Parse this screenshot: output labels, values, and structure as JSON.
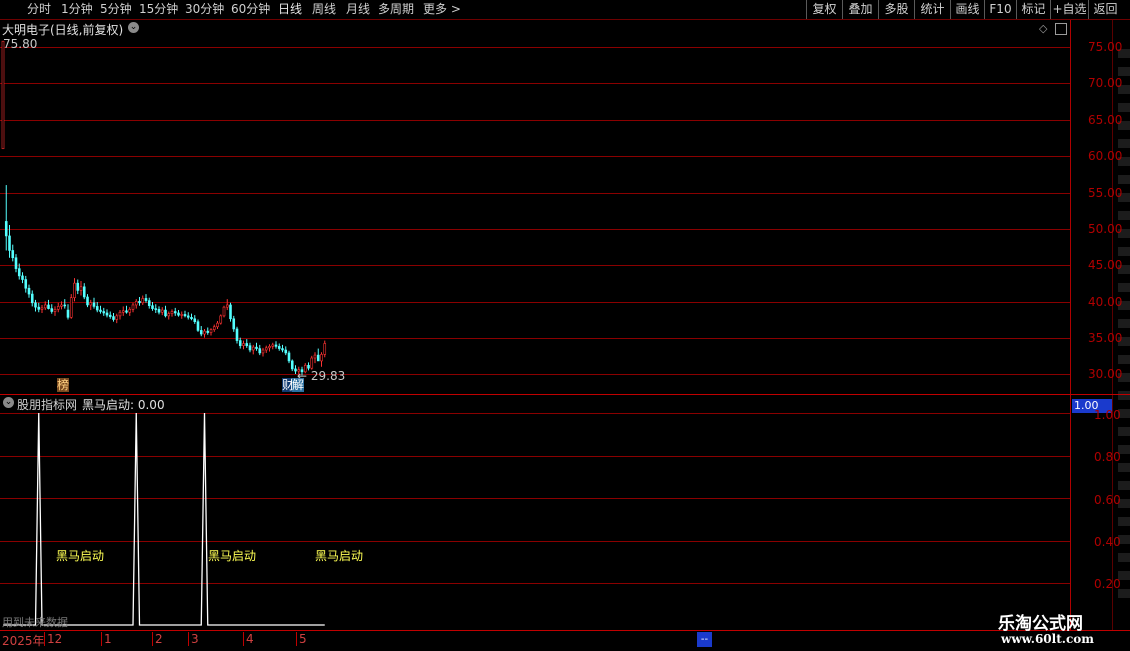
{
  "toolbar": {
    "periods": [
      "分时",
      "1分钟",
      "5分钟",
      "15分钟",
      "30分钟",
      "60分钟",
      "日线",
      "周线",
      "月线",
      "多周期",
      "更多 >"
    ],
    "actions": [
      "复权",
      "叠加",
      "多股",
      "统计",
      "画线",
      "F10",
      "标记",
      "+自选",
      "返回"
    ]
  },
  "main": {
    "title": "大明电子(日线,前复权)",
    "high_label": "75.80",
    "low_label": "← 29.83",
    "badge_left": "榜",
    "badge_right_1": "财",
    "badge_right_2": "解",
    "y_ticks": [
      "75.00",
      "70.00",
      "65.00",
      "60.00",
      "55.00",
      "50.00",
      "45.00",
      "40.00",
      "35.00",
      "30.00"
    ]
  },
  "indicator": {
    "source": "股朋指标网",
    "name_value": "黑马启动: 0.00",
    "signal_label": "黑马启动",
    "current_value": "1.00",
    "y_ticks": [
      "1.00",
      "0.80",
      "0.60",
      "0.40",
      "0.20"
    ],
    "footer_note": "用到未来数据"
  },
  "time_axis": {
    "labels": [
      "2025年",
      "12",
      "1",
      "2",
      "3",
      "4",
      "5"
    ],
    "marker": "--"
  },
  "colors": {
    "up": "#ff3232",
    "down": "#54ffff",
    "grid": "#8a0000",
    "axis": "#c00000",
    "signal": "#ffff54"
  },
  "watermark": {
    "title": "乐淘公式网",
    "url": "www.60lt.com"
  },
  "chart_data": {
    "type": "candlestick",
    "ylim": [
      28,
      77
    ],
    "candles": [
      [
        61.0,
        75.8,
        61.0,
        75.8
      ],
      [
        51.0,
        56.0,
        47.0,
        49.0
      ],
      [
        49.0,
        50.5,
        46.0,
        47.0
      ],
      [
        47.0,
        47.8,
        45.5,
        46.0
      ],
      [
        46.0,
        46.5,
        44.0,
        44.5
      ],
      [
        44.5,
        45.2,
        43.0,
        43.5
      ],
      [
        43.5,
        44.0,
        42.5,
        43.0
      ],
      [
        43.0,
        43.5,
        41.2,
        41.8
      ],
      [
        41.8,
        42.3,
        40.5,
        41.0
      ],
      [
        41.0,
        41.5,
        39.3,
        39.8
      ],
      [
        39.8,
        40.2,
        38.6,
        39.2
      ],
      [
        39.2,
        39.8,
        38.5,
        38.9
      ],
      [
        38.9,
        39.5,
        38.4,
        39.1
      ],
      [
        39.1,
        40.0,
        38.8,
        39.5
      ],
      [
        39.5,
        40.2,
        38.9,
        39.0
      ],
      [
        39.0,
        39.6,
        38.3,
        38.6
      ],
      [
        38.6,
        39.3,
        38.0,
        38.9
      ],
      [
        38.9,
        39.8,
        38.5,
        39.3
      ],
      [
        39.3,
        40.0,
        38.9,
        39.5
      ],
      [
        39.5,
        40.3,
        39.0,
        39.4
      ],
      [
        38.8,
        39.6,
        37.5,
        37.8
      ],
      [
        37.8,
        41.0,
        37.6,
        40.5
      ],
      [
        40.5,
        43.2,
        40.0,
        42.5
      ],
      [
        42.5,
        43.0,
        41.0,
        41.5
      ],
      [
        41.5,
        42.8,
        40.8,
        42.0
      ],
      [
        42.0,
        42.5,
        40.3,
        40.6
      ],
      [
        40.6,
        41.0,
        39.2,
        39.5
      ],
      [
        39.5,
        40.2,
        38.8,
        39.8
      ],
      [
        39.8,
        40.5,
        39.0,
        39.3
      ],
      [
        39.3,
        39.9,
        38.5,
        38.8
      ],
      [
        38.8,
        39.4,
        38.3,
        38.6
      ],
      [
        38.6,
        39.1,
        38.0,
        38.4
      ],
      [
        38.4,
        38.9,
        37.8,
        38.1
      ],
      [
        38.1,
        38.6,
        37.6,
        37.9
      ],
      [
        37.9,
        38.4,
        37.2,
        37.5
      ],
      [
        37.5,
        38.3,
        37.0,
        38.0
      ],
      [
        38.0,
        38.8,
        37.5,
        38.5
      ],
      [
        38.5,
        39.3,
        38.0,
        38.7
      ],
      [
        38.7,
        39.4,
        38.3,
        38.5
      ],
      [
        38.5,
        39.2,
        38.0,
        38.9
      ],
      [
        38.9,
        39.8,
        38.5,
        39.5
      ],
      [
        39.5,
        40.3,
        39.0,
        40.0
      ],
      [
        40.0,
        40.6,
        39.4,
        39.8
      ],
      [
        39.8,
        40.8,
        39.5,
        40.4
      ],
      [
        40.4,
        41.0,
        39.8,
        40.1
      ],
      [
        40.1,
        40.5,
        39.0,
        39.4
      ],
      [
        39.4,
        39.9,
        38.7,
        39.0
      ],
      [
        39.0,
        39.6,
        38.4,
        38.9
      ],
      [
        38.9,
        39.3,
        38.2,
        38.5
      ],
      [
        38.5,
        39.2,
        38.1,
        38.8
      ],
      [
        38.8,
        39.4,
        37.8,
        38.0
      ],
      [
        38.0,
        38.6,
        37.5,
        38.3
      ],
      [
        38.3,
        38.9,
        37.9,
        38.6
      ],
      [
        38.6,
        39.1,
        38.0,
        38.4
      ],
      [
        38.4,
        38.8,
        37.9,
        38.1
      ],
      [
        38.1,
        38.6,
        37.6,
        38.2
      ],
      [
        38.2,
        38.7,
        37.8,
        38.0
      ],
      [
        38.0,
        38.5,
        37.5,
        37.8
      ],
      [
        37.8,
        38.3,
        37.4,
        37.6
      ],
      [
        37.6,
        38.1,
        36.9,
        37.2
      ],
      [
        37.2,
        37.5,
        35.8,
        36.0
      ],
      [
        36.0,
        36.6,
        35.2,
        35.5
      ],
      [
        35.5,
        36.2,
        35.0,
        35.9
      ],
      [
        35.9,
        36.4,
        35.4,
        35.7
      ],
      [
        35.7,
        36.3,
        35.3,
        36.1
      ],
      [
        36.1,
        36.8,
        35.8,
        36.5
      ],
      [
        36.5,
        37.3,
        36.2,
        37.0
      ],
      [
        37.0,
        38.2,
        36.8,
        38.0
      ],
      [
        38.0,
        39.4,
        37.8,
        39.2
      ],
      [
        39.2,
        40.3,
        38.8,
        39.5
      ],
      [
        39.5,
        39.8,
        37.2,
        37.6
      ],
      [
        37.6,
        38.0,
        35.8,
        36.2
      ],
      [
        36.2,
        36.5,
        34.2,
        34.6
      ],
      [
        34.6,
        35.0,
        33.5,
        33.9
      ],
      [
        33.9,
        34.6,
        33.4,
        34.2
      ],
      [
        34.2,
        34.8,
        33.6,
        33.9
      ],
      [
        33.9,
        34.3,
        33.0,
        33.3
      ],
      [
        33.3,
        34.0,
        32.7,
        33.7
      ],
      [
        33.7,
        34.3,
        33.2,
        33.5
      ],
      [
        33.5,
        34.0,
        32.6,
        32.9
      ],
      [
        32.9,
        33.6,
        32.4,
        33.3
      ],
      [
        33.3,
        33.9,
        32.9,
        33.6
      ],
      [
        33.6,
        34.1,
        33.1,
        33.8
      ],
      [
        33.8,
        34.3,
        33.4,
        34.0
      ],
      [
        34.0,
        34.5,
        33.5,
        33.8
      ],
      [
        33.8,
        34.2,
        33.2,
        33.5
      ],
      [
        33.5,
        34.0,
        33.0,
        33.3
      ],
      [
        33.3,
        33.8,
        32.6,
        32.9
      ],
      [
        32.9,
        33.2,
        31.5,
        31.8
      ],
      [
        31.8,
        32.0,
        30.4,
        30.7
      ],
      [
        30.7,
        31.2,
        30.0,
        30.4
      ],
      [
        30.4,
        31.0,
        29.9,
        30.6
      ],
      [
        30.6,
        31.0,
        29.83,
        30.3
      ],
      [
        30.3,
        31.5,
        30.1,
        31.2
      ],
      [
        31.2,
        31.6,
        30.5,
        30.8
      ],
      [
        30.8,
        32.5,
        30.6,
        32.2
      ],
      [
        32.2,
        33.0,
        31.5,
        32.6
      ],
      [
        32.6,
        33.5,
        31.8,
        31.8
      ],
      [
        31.8,
        33.0,
        31.0,
        32.7
      ],
      [
        32.7,
        34.6,
        32.3,
        34.2
      ]
    ],
    "signal_days": [
      11,
      41,
      62
    ]
  }
}
